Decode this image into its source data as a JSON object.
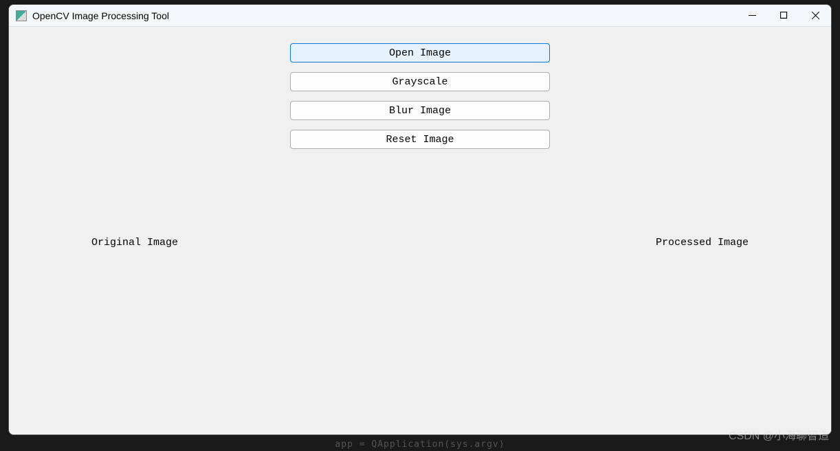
{
  "window": {
    "title": "OpenCV Image Processing Tool"
  },
  "buttons": {
    "open_image": "Open Image",
    "grayscale": "Grayscale",
    "blur_image": "Blur Image",
    "reset_image": "Reset Image"
  },
  "labels": {
    "original": "Original Image",
    "processed": "Processed Image"
  },
  "watermark": "CSDN @小海聊智造",
  "bg_code": "app = QApplication(sys.argv)"
}
